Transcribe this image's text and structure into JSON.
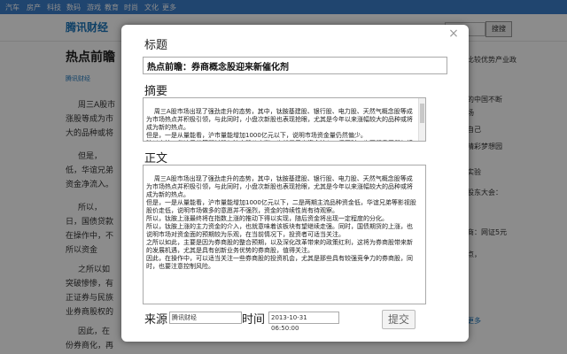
{
  "topnav": {
    "items": [
      "汽车",
      "房产",
      "科技",
      "数码",
      "游戏",
      "教育",
      "时尚",
      "文化",
      "更多"
    ]
  },
  "header": {
    "logo": "腾讯财经",
    "search_button": "搜搜"
  },
  "background": {
    "page_title": "热点前瞻",
    "meta": "腾讯财经",
    "paragraphs": [
      "周三A股市",
      "涨股等成为市",
      "大的品种或将",
      "但是，",
      "低，华谊兄弟",
      "资金净流入。",
      "所以，",
      "日，国债贷款",
      "在操作中，不",
      "所以资金",
      "之所以如",
      "突破惨惨，有",
      "正证券与民族",
      "业券商股权的",
      "因此，在",
      "份券商化，再"
    ],
    "right_items": [
      "比较优势产业政",
      "的中国不断",
      "场",
      "自己",
      "精彩梦想园",
      "实验",
      "股东大会：",
      "商：网证5元",
      "点，"
    ],
    "right_more": "更多"
  },
  "modal": {
    "labels": {
      "title": "标题",
      "summary": "摘要",
      "body": "正文",
      "source": "来源",
      "time": "时间"
    },
    "title_value": "热点前瞻：券商概念股迎来新催化剂",
    "summary_text": "周三A股市场出现了强劲走升的态势，其中，钛胺基建股、银行股、电力股、天然气概念股等成为市场热点并积极引领，与此同时，小盘次新股也表现抢眼，尤其是今年以来涨幅较大的品种或将成为新的热点。\n但是，一是从量能看，沪市量能增加1000亿元以下，说明市场资金量仍然偏少。\n除以上外，华谊兄弟等题材股与沪市股价上涨，也就显示出资金流入，但同时，也要留意天然气板块的整体走势。",
    "body_text": "周三A股市场出现了强劲走升的态势，其中，钛胺基建股、银行股、电力股、天然气概念股等成为市场热点并积极引领，与此同时，小盘次新股也表现抢眼，尤其是今年以来涨幅较大的品种或将成为新的热点。\n但是，一是从量能看，沪市量能增加1000亿元以下，二是两期主流品种资金低，华谊兄弟等影视股股价走低，说明市场做多的意愿并不强烈，资金的持续性尚有待观察。\n所以，钛胺上涨最终将在指数上涨的推动下得以实现，随后资金将出现一定程度的分化。\n所以，钛胺上涨的主力资金的介入，也就意味着该板块有望继续走强。同时，国债期货的上涨，也说明市场对资金面的预期较为乐观，在当前情况下，投资者可适当关注。\n之所以如此，主要是因为券商股的整合预期，以及深化改革带来的政策红利，这将为券商股带来新的发展机遇，尤其是具有创新业务优势的券商股，值得关注。\n因此，在操作中，可以适当关注一些券商股的投资机会，尤其是那些具有较强竞争力的券商股，同时，也要注意控制风险。",
    "source_value": "腾讯财经",
    "time_value": "2013-10-31 06:50:00",
    "submit_label": "提交",
    "close_glyph": "×"
  }
}
